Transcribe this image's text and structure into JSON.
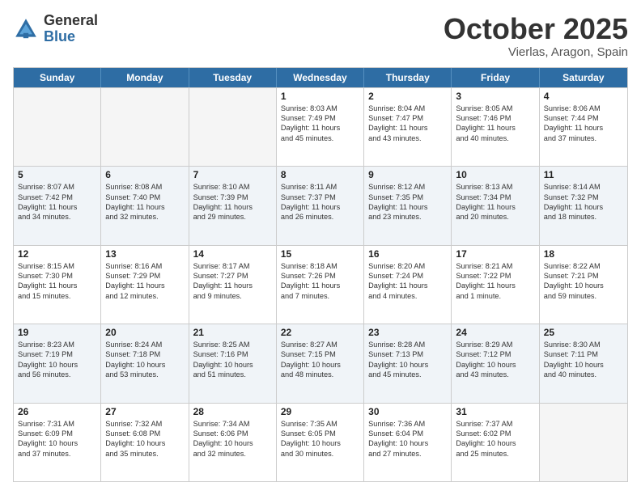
{
  "logo": {
    "general": "General",
    "blue": "Blue"
  },
  "title": "October 2025",
  "location": "Vierlas, Aragon, Spain",
  "days": [
    "Sunday",
    "Monday",
    "Tuesday",
    "Wednesday",
    "Thursday",
    "Friday",
    "Saturday"
  ],
  "rows": [
    [
      {
        "num": "",
        "lines": [],
        "empty": true
      },
      {
        "num": "",
        "lines": [],
        "empty": true
      },
      {
        "num": "",
        "lines": [],
        "empty": true
      },
      {
        "num": "1",
        "lines": [
          "Sunrise: 8:03 AM",
          "Sunset: 7:49 PM",
          "Daylight: 11 hours",
          "and 45 minutes."
        ],
        "empty": false
      },
      {
        "num": "2",
        "lines": [
          "Sunrise: 8:04 AM",
          "Sunset: 7:47 PM",
          "Daylight: 11 hours",
          "and 43 minutes."
        ],
        "empty": false
      },
      {
        "num": "3",
        "lines": [
          "Sunrise: 8:05 AM",
          "Sunset: 7:46 PM",
          "Daylight: 11 hours",
          "and 40 minutes."
        ],
        "empty": false
      },
      {
        "num": "4",
        "lines": [
          "Sunrise: 8:06 AM",
          "Sunset: 7:44 PM",
          "Daylight: 11 hours",
          "and 37 minutes."
        ],
        "empty": false
      }
    ],
    [
      {
        "num": "5",
        "lines": [
          "Sunrise: 8:07 AM",
          "Sunset: 7:42 PM",
          "Daylight: 11 hours",
          "and 34 minutes."
        ],
        "empty": false
      },
      {
        "num": "6",
        "lines": [
          "Sunrise: 8:08 AM",
          "Sunset: 7:40 PM",
          "Daylight: 11 hours",
          "and 32 minutes."
        ],
        "empty": false
      },
      {
        "num": "7",
        "lines": [
          "Sunrise: 8:10 AM",
          "Sunset: 7:39 PM",
          "Daylight: 11 hours",
          "and 29 minutes."
        ],
        "empty": false
      },
      {
        "num": "8",
        "lines": [
          "Sunrise: 8:11 AM",
          "Sunset: 7:37 PM",
          "Daylight: 11 hours",
          "and 26 minutes."
        ],
        "empty": false
      },
      {
        "num": "9",
        "lines": [
          "Sunrise: 8:12 AM",
          "Sunset: 7:35 PM",
          "Daylight: 11 hours",
          "and 23 minutes."
        ],
        "empty": false
      },
      {
        "num": "10",
        "lines": [
          "Sunrise: 8:13 AM",
          "Sunset: 7:34 PM",
          "Daylight: 11 hours",
          "and 20 minutes."
        ],
        "empty": false
      },
      {
        "num": "11",
        "lines": [
          "Sunrise: 8:14 AM",
          "Sunset: 7:32 PM",
          "Daylight: 11 hours",
          "and 18 minutes."
        ],
        "empty": false
      }
    ],
    [
      {
        "num": "12",
        "lines": [
          "Sunrise: 8:15 AM",
          "Sunset: 7:30 PM",
          "Daylight: 11 hours",
          "and 15 minutes."
        ],
        "empty": false
      },
      {
        "num": "13",
        "lines": [
          "Sunrise: 8:16 AM",
          "Sunset: 7:29 PM",
          "Daylight: 11 hours",
          "and 12 minutes."
        ],
        "empty": false
      },
      {
        "num": "14",
        "lines": [
          "Sunrise: 8:17 AM",
          "Sunset: 7:27 PM",
          "Daylight: 11 hours",
          "and 9 minutes."
        ],
        "empty": false
      },
      {
        "num": "15",
        "lines": [
          "Sunrise: 8:18 AM",
          "Sunset: 7:26 PM",
          "Daylight: 11 hours",
          "and 7 minutes."
        ],
        "empty": false
      },
      {
        "num": "16",
        "lines": [
          "Sunrise: 8:20 AM",
          "Sunset: 7:24 PM",
          "Daylight: 11 hours",
          "and 4 minutes."
        ],
        "empty": false
      },
      {
        "num": "17",
        "lines": [
          "Sunrise: 8:21 AM",
          "Sunset: 7:22 PM",
          "Daylight: 11 hours",
          "and 1 minute."
        ],
        "empty": false
      },
      {
        "num": "18",
        "lines": [
          "Sunrise: 8:22 AM",
          "Sunset: 7:21 PM",
          "Daylight: 10 hours",
          "and 59 minutes."
        ],
        "empty": false
      }
    ],
    [
      {
        "num": "19",
        "lines": [
          "Sunrise: 8:23 AM",
          "Sunset: 7:19 PM",
          "Daylight: 10 hours",
          "and 56 minutes."
        ],
        "empty": false
      },
      {
        "num": "20",
        "lines": [
          "Sunrise: 8:24 AM",
          "Sunset: 7:18 PM",
          "Daylight: 10 hours",
          "and 53 minutes."
        ],
        "empty": false
      },
      {
        "num": "21",
        "lines": [
          "Sunrise: 8:25 AM",
          "Sunset: 7:16 PM",
          "Daylight: 10 hours",
          "and 51 minutes."
        ],
        "empty": false
      },
      {
        "num": "22",
        "lines": [
          "Sunrise: 8:27 AM",
          "Sunset: 7:15 PM",
          "Daylight: 10 hours",
          "and 48 minutes."
        ],
        "empty": false
      },
      {
        "num": "23",
        "lines": [
          "Sunrise: 8:28 AM",
          "Sunset: 7:13 PM",
          "Daylight: 10 hours",
          "and 45 minutes."
        ],
        "empty": false
      },
      {
        "num": "24",
        "lines": [
          "Sunrise: 8:29 AM",
          "Sunset: 7:12 PM",
          "Daylight: 10 hours",
          "and 43 minutes."
        ],
        "empty": false
      },
      {
        "num": "25",
        "lines": [
          "Sunrise: 8:30 AM",
          "Sunset: 7:11 PM",
          "Daylight: 10 hours",
          "and 40 minutes."
        ],
        "empty": false
      }
    ],
    [
      {
        "num": "26",
        "lines": [
          "Sunrise: 7:31 AM",
          "Sunset: 6:09 PM",
          "Daylight: 10 hours",
          "and 37 minutes."
        ],
        "empty": false
      },
      {
        "num": "27",
        "lines": [
          "Sunrise: 7:32 AM",
          "Sunset: 6:08 PM",
          "Daylight: 10 hours",
          "and 35 minutes."
        ],
        "empty": false
      },
      {
        "num": "28",
        "lines": [
          "Sunrise: 7:34 AM",
          "Sunset: 6:06 PM",
          "Daylight: 10 hours",
          "and 32 minutes."
        ],
        "empty": false
      },
      {
        "num": "29",
        "lines": [
          "Sunrise: 7:35 AM",
          "Sunset: 6:05 PM",
          "Daylight: 10 hours",
          "and 30 minutes."
        ],
        "empty": false
      },
      {
        "num": "30",
        "lines": [
          "Sunrise: 7:36 AM",
          "Sunset: 6:04 PM",
          "Daylight: 10 hours",
          "and 27 minutes."
        ],
        "empty": false
      },
      {
        "num": "31",
        "lines": [
          "Sunrise: 7:37 AM",
          "Sunset: 6:02 PM",
          "Daylight: 10 hours",
          "and 25 minutes."
        ],
        "empty": false
      },
      {
        "num": "",
        "lines": [],
        "empty": true
      }
    ]
  ]
}
